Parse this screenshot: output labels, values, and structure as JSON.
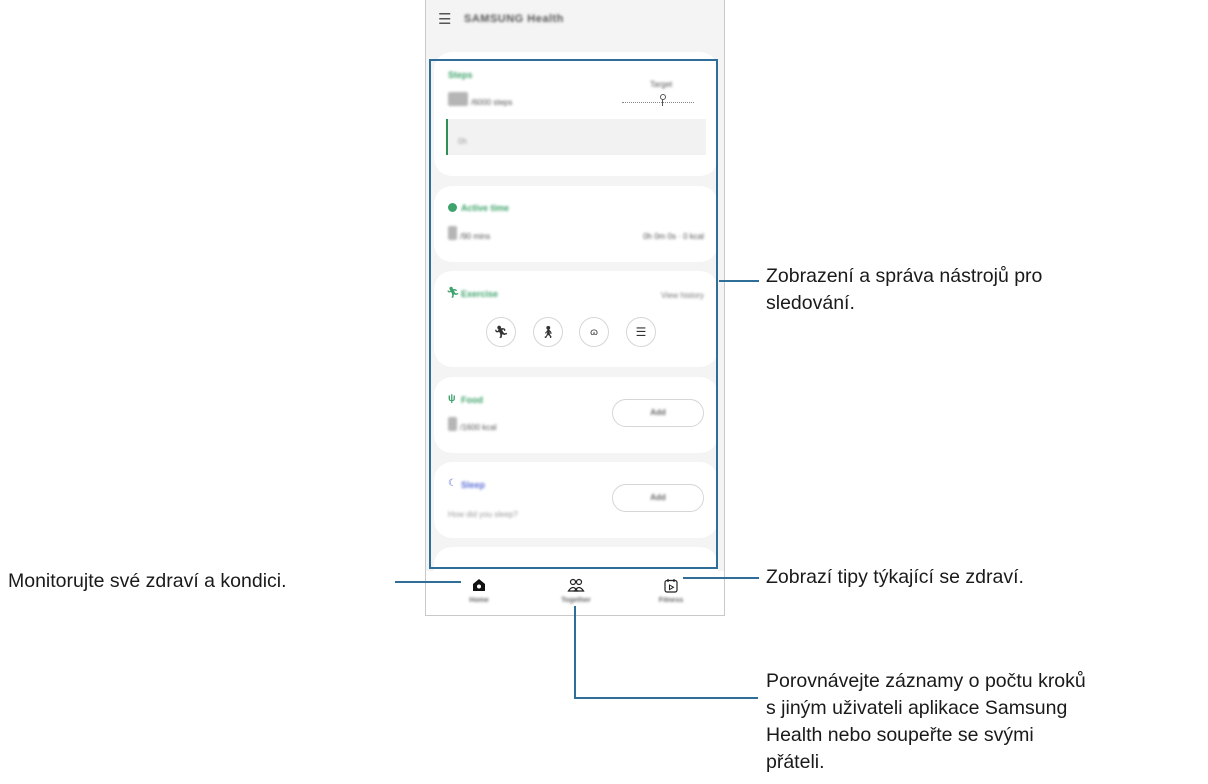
{
  "app": {
    "title": "SAMSUNG Health"
  },
  "steps": {
    "label": "Steps",
    "count": "23",
    "goal": "/6000 steps",
    "target_label": "Target",
    "chart_caption": "0h"
  },
  "active_time": {
    "label": "Active time",
    "value": "0",
    "goal": "/90 mins",
    "detail": "0h 0m 0s · 0 kcal"
  },
  "exercise": {
    "label": "Exercise",
    "view_history": "View history",
    "buttons": [
      "running-icon",
      "walking-icon",
      "cycling-icon",
      "list-icon"
    ]
  },
  "food": {
    "label": "Food",
    "value": "0",
    "goal": "/1600 kcal",
    "add": "Add"
  },
  "sleep": {
    "label": "Sleep",
    "question": "How did you sleep?",
    "add": "Add"
  },
  "nav": {
    "home": "Home",
    "together": "Together",
    "fitness": "Fitness"
  },
  "annotations": {
    "trackers_line1": "Zobrazení a správa nástrojů pro",
    "trackers_line2": "sledování.",
    "home": "Monitorujte své zdraví a kondici.",
    "tips": "Zobrazí tipy týkající se zdraví.",
    "together_line1": "Porovnávejte záznamy o počtu kroků",
    "together_line2": "s jiným uživateli aplikace Samsung",
    "together_line3": "Health nebo soupeřte se svými",
    "together_line4": "přáteli."
  },
  "colors": {
    "accent_green": "#3ea36b",
    "annotation_line": "#2f6e99",
    "sleep_blue": "#5b6fd6"
  }
}
